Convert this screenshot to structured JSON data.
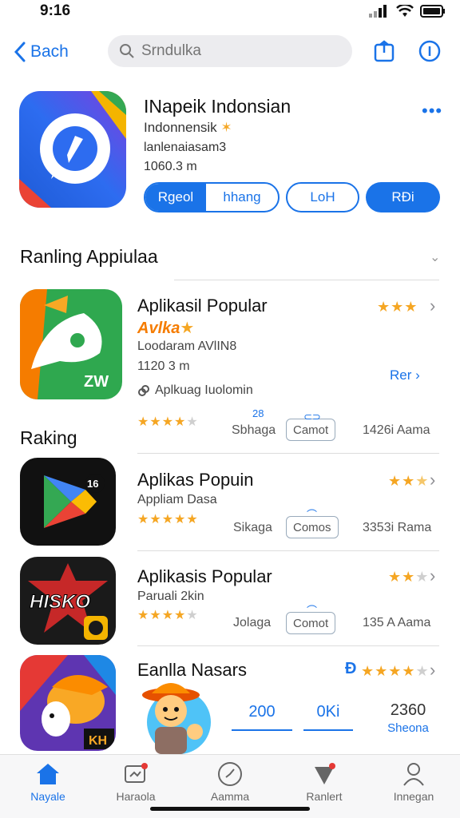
{
  "status": {
    "time": "9:16"
  },
  "nav": {
    "back_label": "Bach",
    "search_placeholder": "Srndulka"
  },
  "hero": {
    "title": "INapeik Indonsian",
    "subtitle": "Indonnensik",
    "line3": "lanlenaiasam3",
    "line4": "1060.3 m",
    "more": "•••",
    "seg_a": "Rgeol",
    "seg_b": "hhang",
    "btn_outline": "LoH",
    "btn_fill": "RĐi"
  },
  "section1": {
    "title": "Ranling Appiulaa"
  },
  "featured": {
    "title": "Aplikasil Popular",
    "badge": "Avlka",
    "dev": "Loodaram AVlIN8",
    "size": "1120 3 m",
    "install_note": "Aplkuag Iuolomin",
    "link": "Rer",
    "stat_left": "Sbhaga",
    "stat_left_num": "28",
    "pill": "Camot",
    "stat_right": "1426i Aama"
  },
  "section2": {
    "title": "Raking"
  },
  "rows": [
    {
      "title": "Aplikas Popuin",
      "sub": "Appliam Dasa",
      "stat_left": "Sikaga",
      "pill": "Comos",
      "stat_right": "3353i Rama"
    },
    {
      "title": "Aplikasis Popular",
      "sub": "Paruali 2kin",
      "stat_left": "Jolaga",
      "pill": "Comot",
      "stat_right": "135 A Aama"
    }
  ],
  "last_row": {
    "title": "Eanlla Nasars",
    "stat_a": "200",
    "stat_b": "0Ki",
    "stat_c": "2360",
    "stat_c_sub": "Sheona"
  },
  "tabs": [
    {
      "label": "Nayale"
    },
    {
      "label": "Haraola"
    },
    {
      "label": "Aamma"
    },
    {
      "label": "Ranlert"
    },
    {
      "label": "Innegan"
    }
  ],
  "colors": {
    "accent": "#1a73e8",
    "star": "#f5a623"
  }
}
